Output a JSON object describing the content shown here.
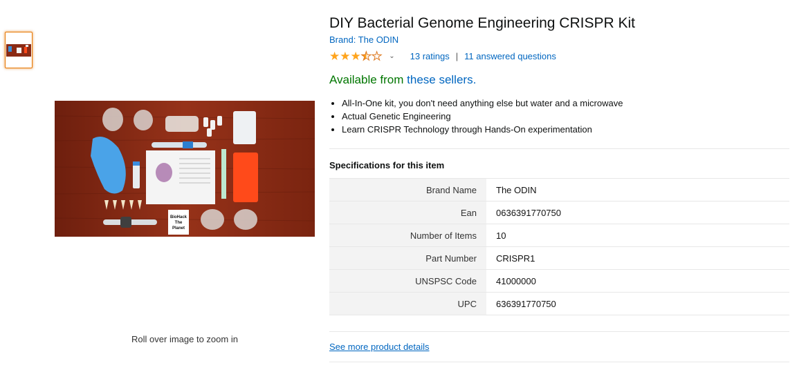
{
  "product": {
    "title": "DIY Bacterial Genome Engineering CRISPR Kit",
    "brand_link": "Brand: The ODIN",
    "rating_stars": 3.5,
    "ratings_count": "13 ratings",
    "separator": "|",
    "answered_questions": "11 answered questions",
    "availability_prefix": "Available from ",
    "availability_link": "these sellers."
  },
  "bullets": [
    "All-In-One kit, you don't need anything else but water and a microwave",
    "Actual Genetic Engineering",
    "Learn CRISPR Technology through Hands-On experimentation"
  ],
  "specs": {
    "heading": "Specifications for this item",
    "rows": [
      {
        "key": "Brand Name",
        "value": "The ODIN"
      },
      {
        "key": "Ean",
        "value": "0636391770750"
      },
      {
        "key": "Number of Items",
        "value": "10"
      },
      {
        "key": "Part Number",
        "value": "CRISPR1"
      },
      {
        "key": "UNSPSC Code",
        "value": "41000000"
      },
      {
        "key": "UPC",
        "value": "636391770750"
      }
    ]
  },
  "gallery": {
    "zoom_hint": "Roll over image to zoom in",
    "image_sign_text": "BioHack The Planet"
  },
  "see_more": "See more product details",
  "colors": {
    "link": "#0066c0",
    "available_green": "#007600",
    "star": "#ffa41c",
    "thumb_border": "#e77600",
    "wood": "#8a2a14"
  }
}
